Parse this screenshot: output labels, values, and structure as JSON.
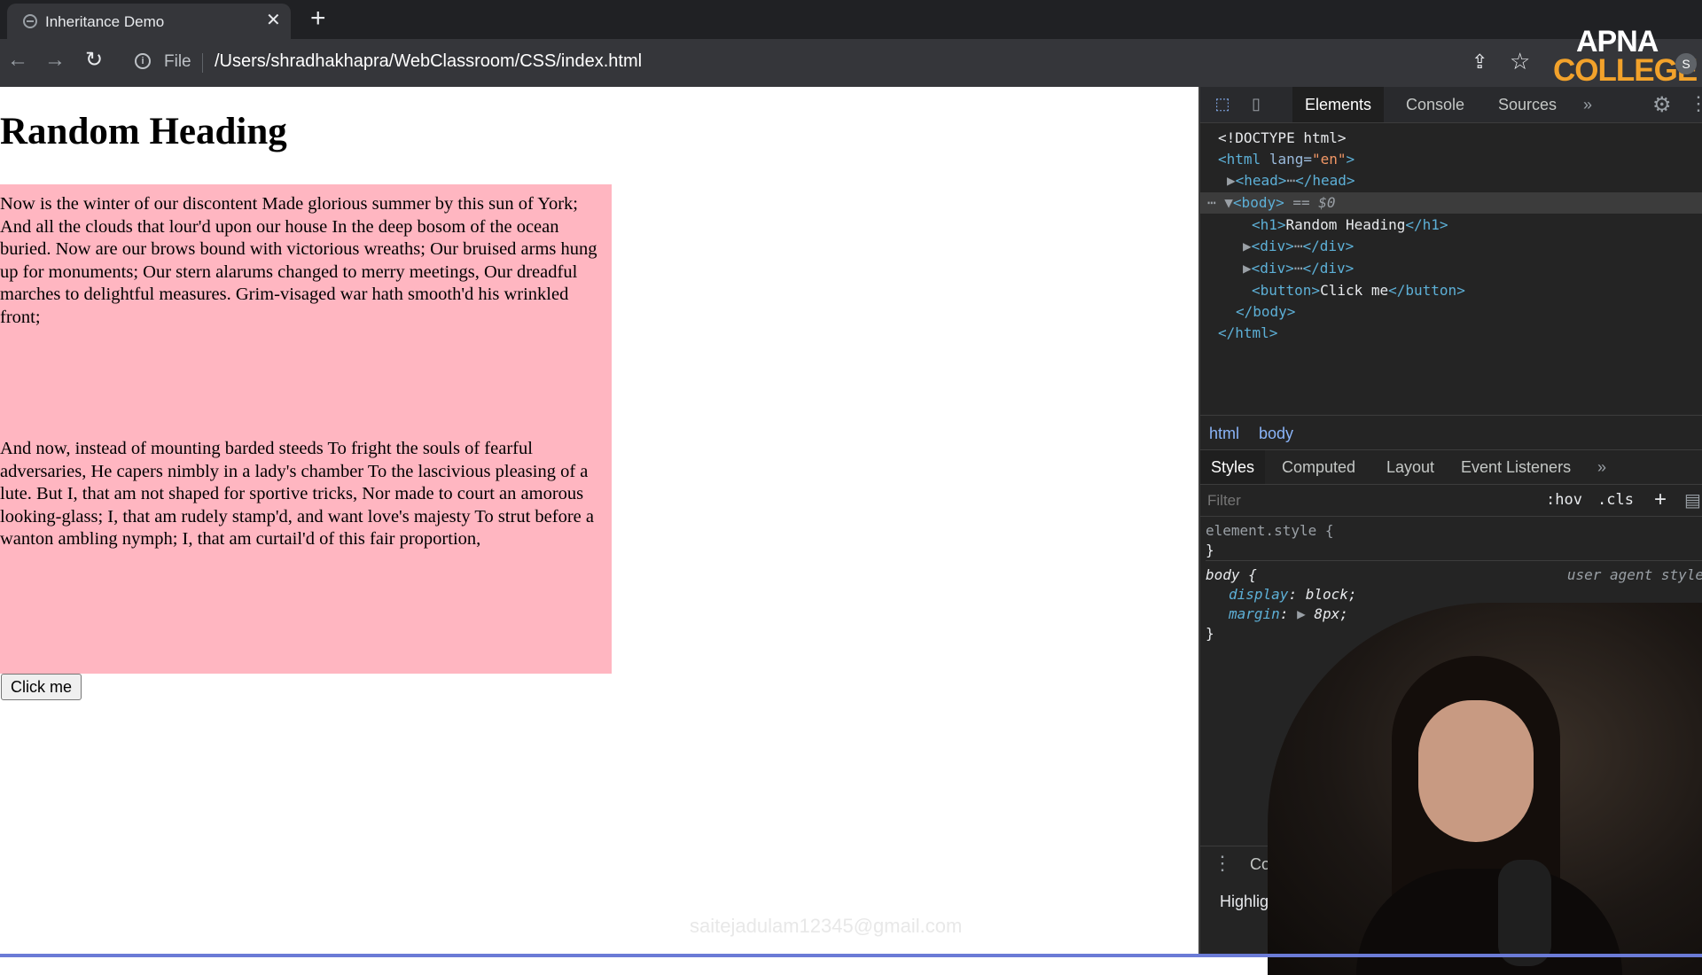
{
  "browser": {
    "tab_title": "Inheritance Demo",
    "tab_close": "✕",
    "new_tab": "+",
    "file_label": "File",
    "url": "/Users/shradhakhapra/WebClassroom/CSS/index.html",
    "avatar_initial": "S"
  },
  "logo": {
    "line1": "APNA",
    "line2": "COLLEGE"
  },
  "page": {
    "heading": "Random Heading",
    "paragraph_1": "Now is the winter of our discontent Made glorious summer by this sun of York; And all the clouds that lour'd upon our house In the deep bosom of the ocean buried. Now are our brows bound with victorious wreaths; Our bruised arms hung up for monuments; Our stern alarums changed to merry meetings, Our dreadful marches to delightful measures. Grim-visaged war hath smooth'd his wrinkled front;",
    "paragraph_2": "And now, instead of mounting barded steeds To fright the souls of fearful adversaries, He capers nimbly in a lady's chamber To the lascivious pleasing of a lute. But I, that am not shaped for sportive tricks, Nor made to court an amorous looking-glass; I, that am rudely stamp'd, and want love's majesty To strut before a wanton ambling nymph; I, that am curtail'd of this fair proportion,",
    "button_label": "Click me",
    "box_color": "#ffb6c1",
    "watermark": "saitejadulam12345@gmail.com"
  },
  "devtools": {
    "tabs": [
      "Elements",
      "Console",
      "Sources"
    ],
    "more_tabs": "»",
    "dom": {
      "doctype": "<!DOCTYPE html>",
      "html_open": "<html",
      "html_attr": "lang",
      "html_attr_value": "\"en\"",
      "head_open": "<head>",
      "head_close": "</head>",
      "ellipsis": "⋯",
      "body_open": "<body>",
      "body_marker": "== $0",
      "h1_open": "<h1>",
      "h1_text": "Random Heading",
      "h1_close": "</h1>",
      "div_open": "<div>",
      "div_close": "</div>",
      "button_open": "<button>",
      "button_text": "Click me",
      "button_close": "</button>",
      "body_close": "</body>",
      "html_close": "</html>"
    },
    "breadcrumbs": [
      "html",
      "body"
    ],
    "styles_tabs": [
      "Styles",
      "Computed",
      "Layout",
      "Event Listeners"
    ],
    "filter_placeholder": "Filter",
    "hov": ":hov",
    "cls": ".cls",
    "element_style": "element.style {",
    "close_brace": "}",
    "body_selector": "body {",
    "user_agent_label": "user agent style",
    "props": [
      {
        "name": "display",
        "value": "block;"
      },
      {
        "name": "margin",
        "value": "8px;"
      }
    ],
    "drawer_console": "Consol",
    "drawer_highlights": "Highlights fro"
  }
}
